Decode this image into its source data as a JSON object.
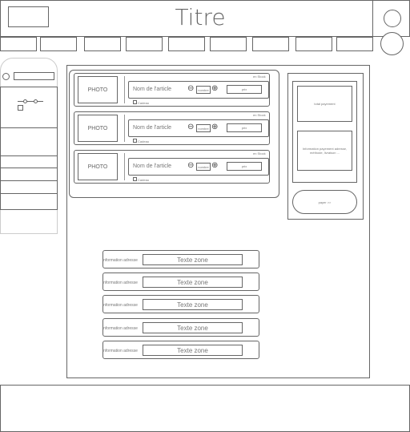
{
  "header": {
    "title": "Titre"
  },
  "nav": {
    "items": [
      "",
      "",
      "",
      "",
      "",
      "",
      "",
      "",
      ""
    ]
  },
  "cart": {
    "items": [
      {
        "photo": "PHOTO",
        "stock": "en Stock",
        "name": "Nom de l'article",
        "qty": "nombre",
        "price": "prix",
        "gift": "Cadeau"
      },
      {
        "photo": "PHOTO",
        "stock": "en Stock",
        "name": "Nom de l'article",
        "qty": "nombre",
        "price": "prix",
        "gift": "Cadeau"
      },
      {
        "photo": "PHOTO",
        "stock": "en Stock",
        "name": "Nom de l'article",
        "qty": "nombre",
        "price": "prix",
        "gift": "Cadeau"
      }
    ]
  },
  "summary": {
    "total": "total payement",
    "info": "Information payement adresse, méthode, livraison ...",
    "pay": "payer >>"
  },
  "address": {
    "rows": [
      {
        "label": "information adresse",
        "value": "Texte zone"
      },
      {
        "label": "information adresse",
        "value": "Texte zone"
      },
      {
        "label": "information adresse",
        "value": "Texte zone"
      },
      {
        "label": "information adresse",
        "value": "Texte zone"
      },
      {
        "label": "information adresse",
        "value": "Texte zone"
      }
    ]
  },
  "icons": {
    "minus": "⊖",
    "plus": "⊕"
  },
  "colors": {
    "line": "#666666",
    "background": "#ffffff"
  }
}
